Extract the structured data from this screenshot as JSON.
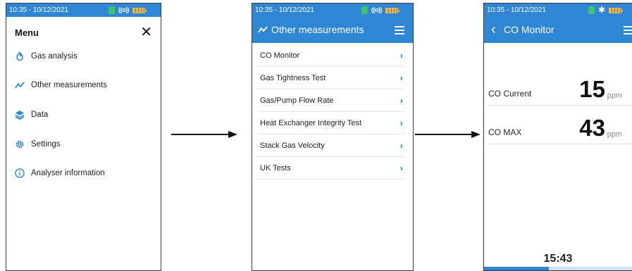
{
  "status": {
    "time": "10:35 - 10/12/2021"
  },
  "menu": {
    "title": "Menu",
    "close": "✕",
    "items": [
      {
        "label": "Gas analysis",
        "icon": "flame-icon"
      },
      {
        "label": "Other measurements",
        "icon": "trend-icon"
      },
      {
        "label": "Data",
        "icon": "layers-icon"
      },
      {
        "label": "Settings",
        "icon": "gear-icon"
      },
      {
        "label": "Analyser information",
        "icon": "info-icon"
      }
    ]
  },
  "other": {
    "title": "Other measurements",
    "items": [
      {
        "label": "CO Monitor"
      },
      {
        "label": "Gas Tightness Test"
      },
      {
        "label": "Gas/Pump Flow Rate"
      },
      {
        "label": "Heat Exchanger Integrity Test"
      },
      {
        "label": "Stack Gas Velocity"
      },
      {
        "label": "UK Tests"
      }
    ]
  },
  "co_monitor": {
    "back": "‹",
    "title": "CO Monitor",
    "rows": [
      {
        "label": "CO Current",
        "value": "15",
        "unit": "ppm"
      },
      {
        "label": "CO MAX",
        "value": "43",
        "unit": "ppm"
      }
    ],
    "timer": "15:43",
    "progress": 0.44
  },
  "colors": {
    "accent": "#2f86d5",
    "battery": "#f7b23c",
    "sd_card": "#3cc46a"
  }
}
